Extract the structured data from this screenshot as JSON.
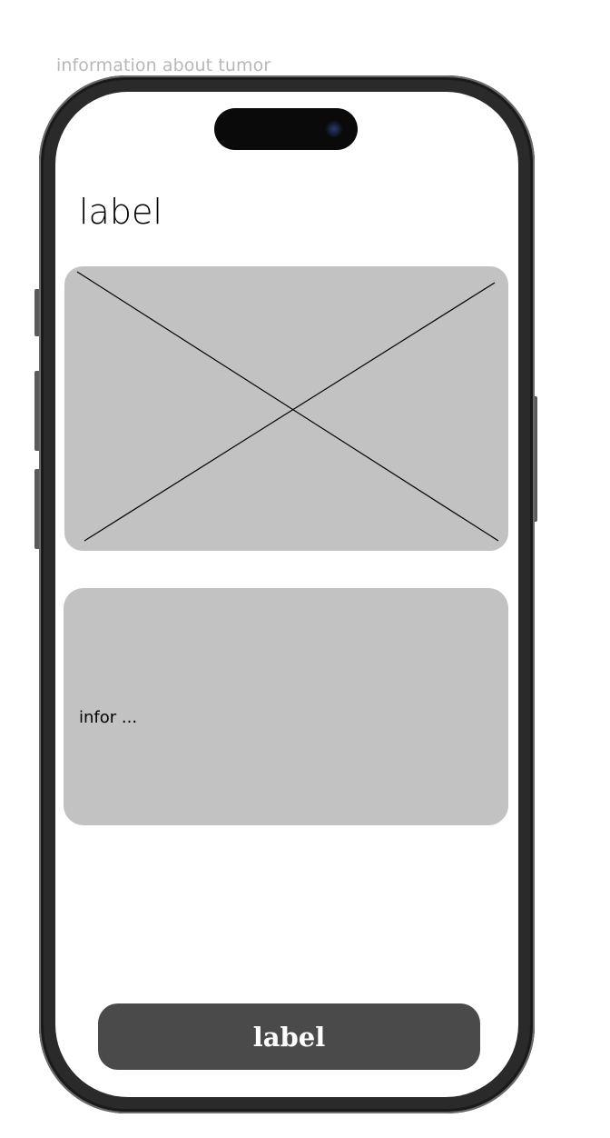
{
  "frame": {
    "label": "information about tumor"
  },
  "screen": {
    "title": "label",
    "info_card": {
      "text": "infor ..."
    },
    "primary_button": {
      "label": "label"
    }
  },
  "icons": {
    "camera": "front-camera-icon",
    "image_placeholder": "image-placeholder-icon"
  },
  "colors": {
    "placeholder": "#c2c2c2",
    "button": "#4a4a4a",
    "button_text": "#ffffff",
    "frame_label": "#b8b8b8"
  }
}
